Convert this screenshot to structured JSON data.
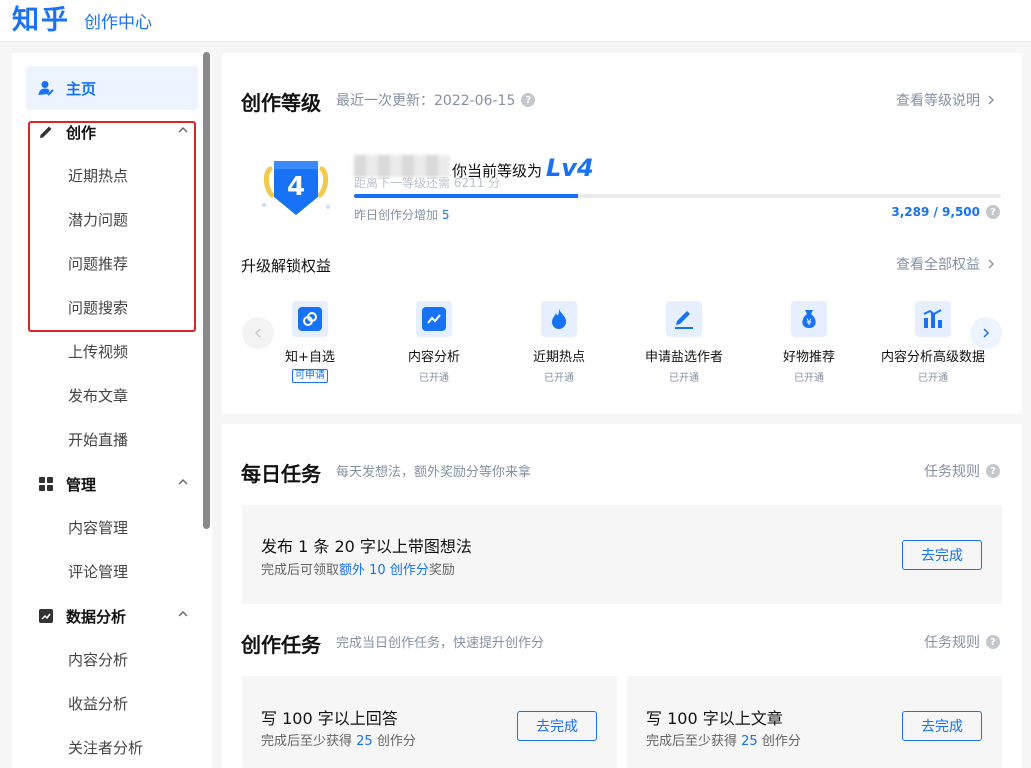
{
  "header": {
    "logo": "知乎",
    "subtitle": "创作中心"
  },
  "sidebar": {
    "home": "主页",
    "groups": [
      {
        "label": "创作",
        "items": [
          "近期热点",
          "潜力问题",
          "问题推荐",
          "问题搜索",
          "上传视频",
          "发布文章",
          "开始直播"
        ]
      },
      {
        "label": "管理",
        "items": [
          "内容管理",
          "评论管理"
        ]
      },
      {
        "label": "数据分析",
        "items": [
          "内容分析",
          "收益分析",
          "关注者分析"
        ]
      }
    ]
  },
  "level": {
    "title": "创作等级",
    "updated": "最近一次更新：2022-06-15",
    "link": "查看等级说明",
    "badge_number": "4",
    "current_text": "你当前等级为",
    "current_level": "Lv4",
    "next_hint": "距离下一等级还需 6211 分",
    "yesterday_label": "昨日创作分增加",
    "yesterday_value": "5",
    "score": "3,289 / 9,500",
    "progress": 0.346
  },
  "benefits": {
    "title": "升级解锁权益",
    "link": "查看全部权益",
    "items": [
      {
        "name": "知+自选",
        "status": "可申请",
        "icon": "link-icon"
      },
      {
        "name": "内容分析",
        "status": "已开通",
        "icon": "trend-icon"
      },
      {
        "name": "近期热点",
        "status": "已开通",
        "icon": "flame-icon"
      },
      {
        "name": "申请盐选作者",
        "status": "已开通",
        "icon": "pen-icon"
      },
      {
        "name": "好物推荐",
        "status": "已开通",
        "icon": "money-bag-icon"
      },
      {
        "name": "内容分析高级数据",
        "status": "已开通",
        "icon": "bar-chart-icon"
      }
    ]
  },
  "daily": {
    "title": "每日任务",
    "subtitle": "每天发想法，额外奖励分等你来拿",
    "rules": "任务规则",
    "task": {
      "main": "发布 1 条 20 字以上带图想法",
      "note_prefix": "完成后可领取",
      "note_highlight": "额外 10 创作分",
      "note_suffix": "奖励",
      "button": "去完成"
    }
  },
  "creation": {
    "title": "创作任务",
    "subtitle": "完成当日创作任务，快速提升创作分",
    "rules": "任务规则",
    "tasks": [
      {
        "main": "写 100 字以上回答",
        "note_prefix": "完成后至少获得",
        "note_highlight": "25",
        "note_suffix": "创作分",
        "button": "去完成"
      },
      {
        "main": "写 100 字以上文章",
        "note_prefix": "完成后至少获得",
        "note_highlight": "25",
        "note_suffix": "创作分",
        "button": "去完成"
      }
    ]
  },
  "colors": {
    "brand": "#1772f6",
    "highlight_border": "#e02424"
  }
}
